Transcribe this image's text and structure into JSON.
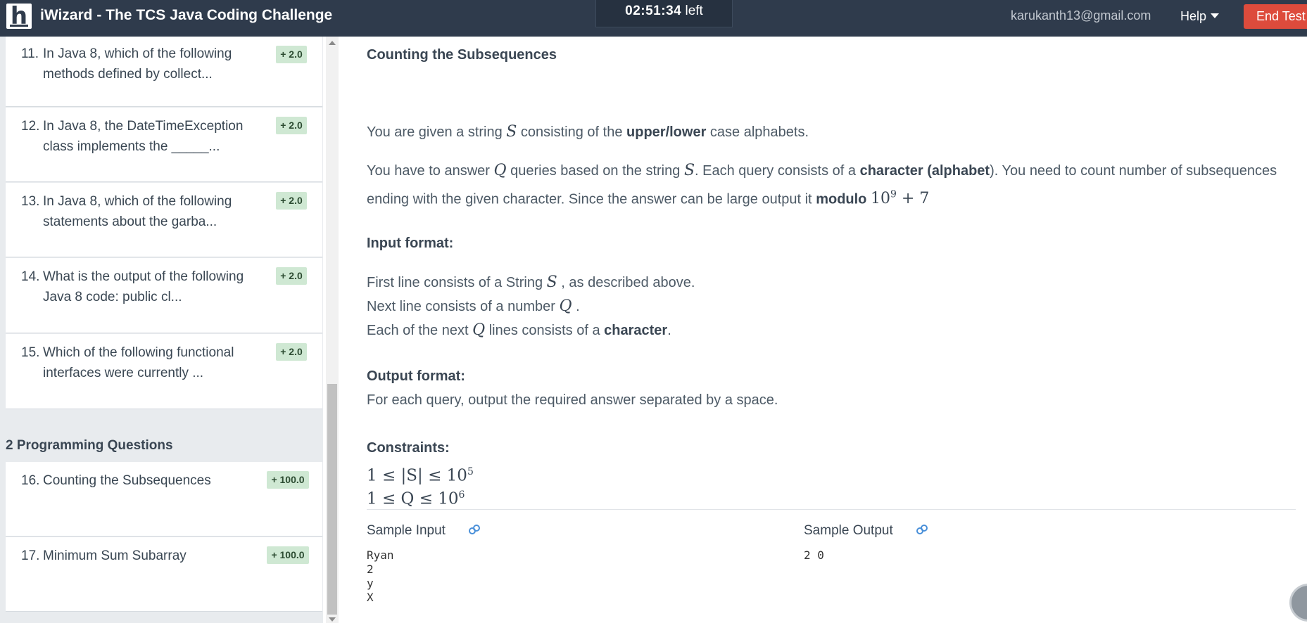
{
  "header": {
    "logo_letter": "h",
    "title": "iWizard - The TCS Java Coding Challenge",
    "timer_value": "02:51:34",
    "timer_suffix": "left",
    "user_email": "karukanth13@gmail.com",
    "help_label": "Help",
    "end_test_label": "End Test"
  },
  "sidebar": {
    "questions": [
      {
        "num": "11.",
        "text": "In Java 8, which of the following methods defined by collect...",
        "score": "+ 2.0"
      },
      {
        "num": "12.",
        "text": "In Java 8, the DateTimeException class implements the _____...",
        "score": "+ 2.0"
      },
      {
        "num": "13.",
        "text": "In Java 8, which of the following statements about the garba...",
        "score": "+ 2.0"
      },
      {
        "num": "14.",
        "text": "What is the output of the following Java 8 code: public cl...",
        "score": "+ 2.0"
      },
      {
        "num": "15.",
        "text": "Which of the following functional interfaces were currently ...",
        "score": "+ 2.0"
      }
    ],
    "section_title": "2 Programming Questions",
    "programming": [
      {
        "num": "16.",
        "text": "Counting the Subsequences",
        "score": "+ 100.0"
      },
      {
        "num": "17.",
        "text": "Minimum Sum Subarray",
        "score": "+ 100.0"
      }
    ]
  },
  "problem": {
    "title": "Counting the Subsequences",
    "p1_a": "You are given a string ",
    "p1_var": "S",
    "p1_b": " consisting of the ",
    "p1_bold": "upper/lower",
    "p1_c": " case alphabets.",
    "p2_a": "You have to answer ",
    "p2_var_q": "Q",
    "p2_b": " queries based on the string ",
    "p2_var_s": "S",
    "p2_c": ". Each query consists of a ",
    "p2_bold1": "character (alphabet",
    "p2_d": "). You need to count number of subsequences ending with the given character. Since the answer can be large output it ",
    "p2_bold2": "modulo",
    "p2_mod_base": "10",
    "p2_mod_exp": "9",
    "p2_mod_tail": "+ 7",
    "input_heading": "Input format:",
    "in1_a": "First line consists of a String ",
    "in1_var": "S",
    "in1_b": " , as described above.",
    "in2_a": "Next line consists of a number ",
    "in2_var": "Q",
    "in2_b": " .",
    "in3_a": "Each of the next ",
    "in3_var": "Q",
    "in3_b": " lines consists of a ",
    "in3_bold": "character",
    "in3_c": ".",
    "output_heading": "Output format:",
    "output_text": "For each query, output the required answer separated by a space.",
    "constraints_heading": "Constraints:",
    "c1_main": "1 ≤ |S| ≤ 10",
    "c1_exp": "5",
    "c2_main": "1 ≤ Q ≤ 10",
    "c2_exp": "6",
    "sample_input_label": "Sample Input",
    "sample_output_label": "Sample Output",
    "sample_input": "Ryan\n2\ny\nX",
    "sample_output": "2 0"
  },
  "colors": {
    "header_bg": "#2f3b4c",
    "end_test_bg": "#dd4b3c",
    "badge_bg": "#cfe8d3",
    "link_blue": "#4a90d9"
  }
}
